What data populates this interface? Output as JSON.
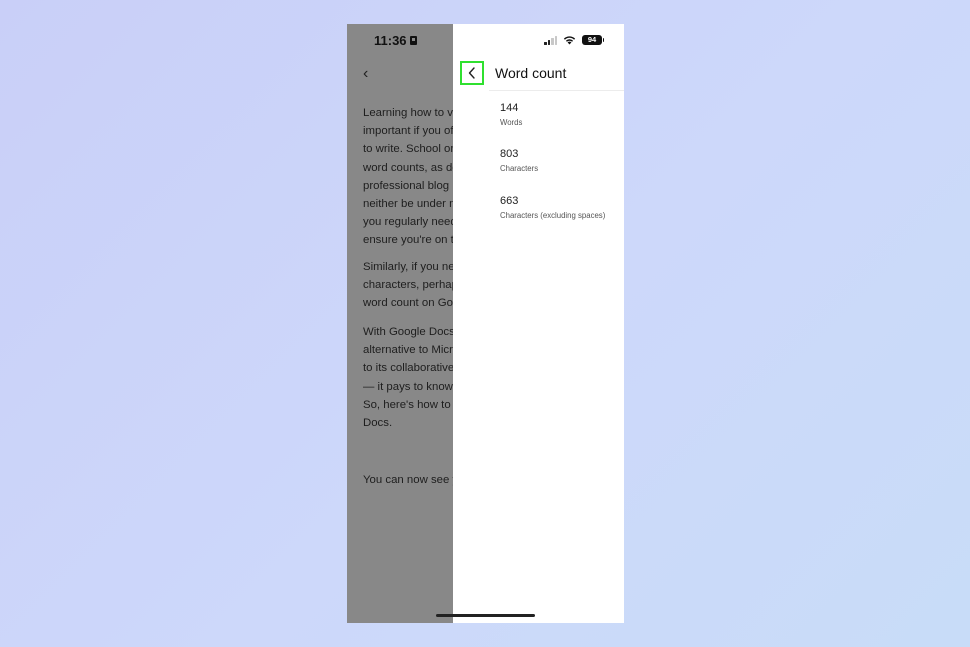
{
  "status_bar": {
    "time": "11:36",
    "battery": "94"
  },
  "document": {
    "paragraphs": [
      [
        "Learning how to vie",
        "important if you ofte",
        "to write. School or c",
        "word counts, as do",
        "professional blog p",
        "neither be under no",
        "you regularly need",
        "ensure you're on tra"
      ],
      [
        "Similarly, if you nee",
        "characters, perhaps",
        "word count on Goo"
      ],
      [
        "With Google Docs b",
        "alternative to Micros",
        "to its collaborative f",
        "— it pays to know y",
        "So, here's how to c",
        "Docs."
      ],
      [
        "You can now see yo"
      ]
    ]
  },
  "panel": {
    "title": "Word count",
    "stats": [
      {
        "value": "144",
        "label": "Words"
      },
      {
        "value": "803",
        "label": "Characters"
      },
      {
        "value": "663",
        "label": "Characters (excluding spaces)"
      }
    ]
  },
  "icons": {
    "back": "chevron-left-icon",
    "highlight_color": "#2fe02f"
  }
}
